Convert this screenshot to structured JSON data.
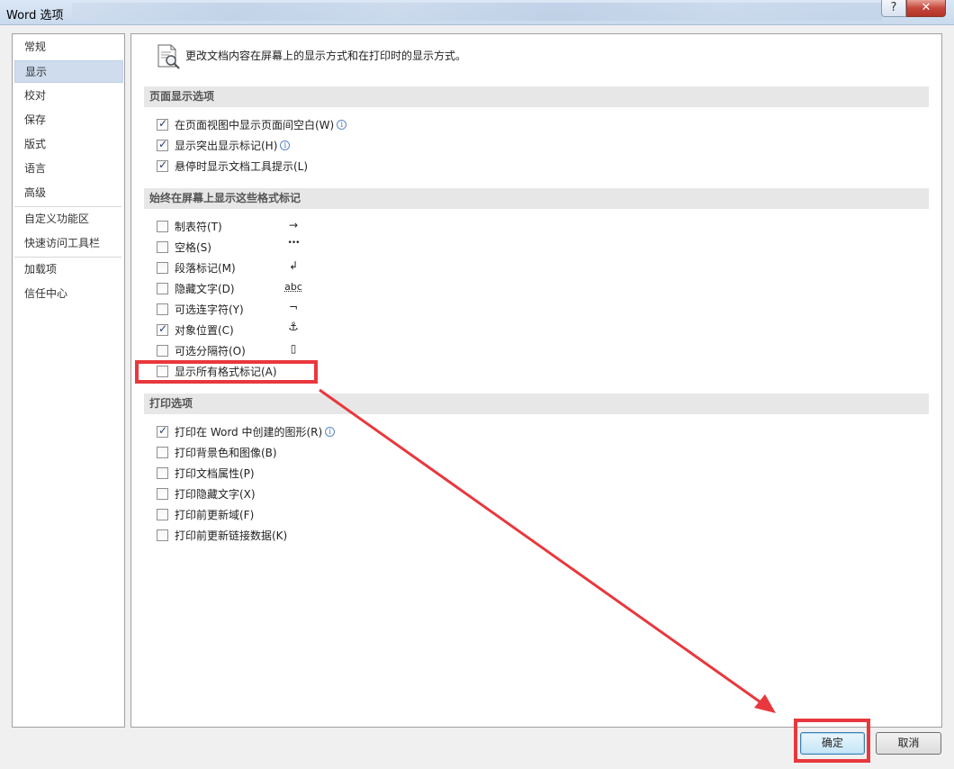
{
  "window": {
    "title": "Word 选项",
    "help_glyph": "?",
    "close_glyph": "✕"
  },
  "nav": {
    "items": [
      {
        "label": "常规"
      },
      {
        "label": "显示"
      },
      {
        "label": "校对"
      },
      {
        "label": "保存"
      },
      {
        "label": "版式"
      },
      {
        "label": "语言"
      },
      {
        "label": "高级"
      },
      {
        "label": "自定义功能区"
      },
      {
        "label": "快速访问工具栏"
      },
      {
        "label": "加载项"
      },
      {
        "label": "信任中心"
      }
    ],
    "selected": "显示"
  },
  "content": {
    "intro": "更改文档内容在屏幕上的显示方式和在打印时的显示方式。",
    "sections": {
      "page_display": "页面显示选项",
      "format_marks": "始终在屏幕上显示这些格式标记",
      "print": "打印选项"
    },
    "page_display_options": [
      {
        "label": "在页面视图中显示页面间空白(W)",
        "checked": true,
        "info": true
      },
      {
        "label": "显示突出显示标记(H)",
        "checked": true,
        "info": true
      },
      {
        "label": "悬停时显示文档工具提示(L)",
        "checked": true,
        "info": false
      }
    ],
    "format_marks_options": [
      {
        "label": "制表符(T)",
        "checked": false,
        "symbol": "→"
      },
      {
        "label": "空格(S)",
        "checked": false,
        "symbol": "•••"
      },
      {
        "label": "段落标记(M)",
        "checked": false,
        "symbol": "↲"
      },
      {
        "label": "隐藏文字(D)",
        "checked": false,
        "symbol": "abc"
      },
      {
        "label": "可选连字符(Y)",
        "checked": false,
        "symbol": "¬"
      },
      {
        "label": "对象位置(C)",
        "checked": true,
        "symbol": "⚓"
      },
      {
        "label": "可选分隔符(O)",
        "checked": false,
        "symbol": "▯"
      },
      {
        "label": "显示所有格式标记(A)",
        "checked": false,
        "symbol": ""
      }
    ],
    "print_options": [
      {
        "label": "打印在 Word 中创建的图形(R)",
        "checked": true,
        "info": true
      },
      {
        "label": "打印背景色和图像(B)",
        "checked": false,
        "info": false
      },
      {
        "label": "打印文档属性(P)",
        "checked": false,
        "info": false
      },
      {
        "label": "打印隐藏文字(X)",
        "checked": false,
        "info": false
      },
      {
        "label": "打印前更新域(F)",
        "checked": false,
        "info": false
      },
      {
        "label": "打印前更新链接数据(K)",
        "checked": false,
        "info": false
      }
    ],
    "info_glyph": "i"
  },
  "footer": {
    "ok_label": "确定",
    "cancel_label": "取消"
  },
  "colors": {
    "annotation": "#e8383d",
    "selected_nav": "#cfdcee",
    "section_bg": "#e7e7e7"
  }
}
